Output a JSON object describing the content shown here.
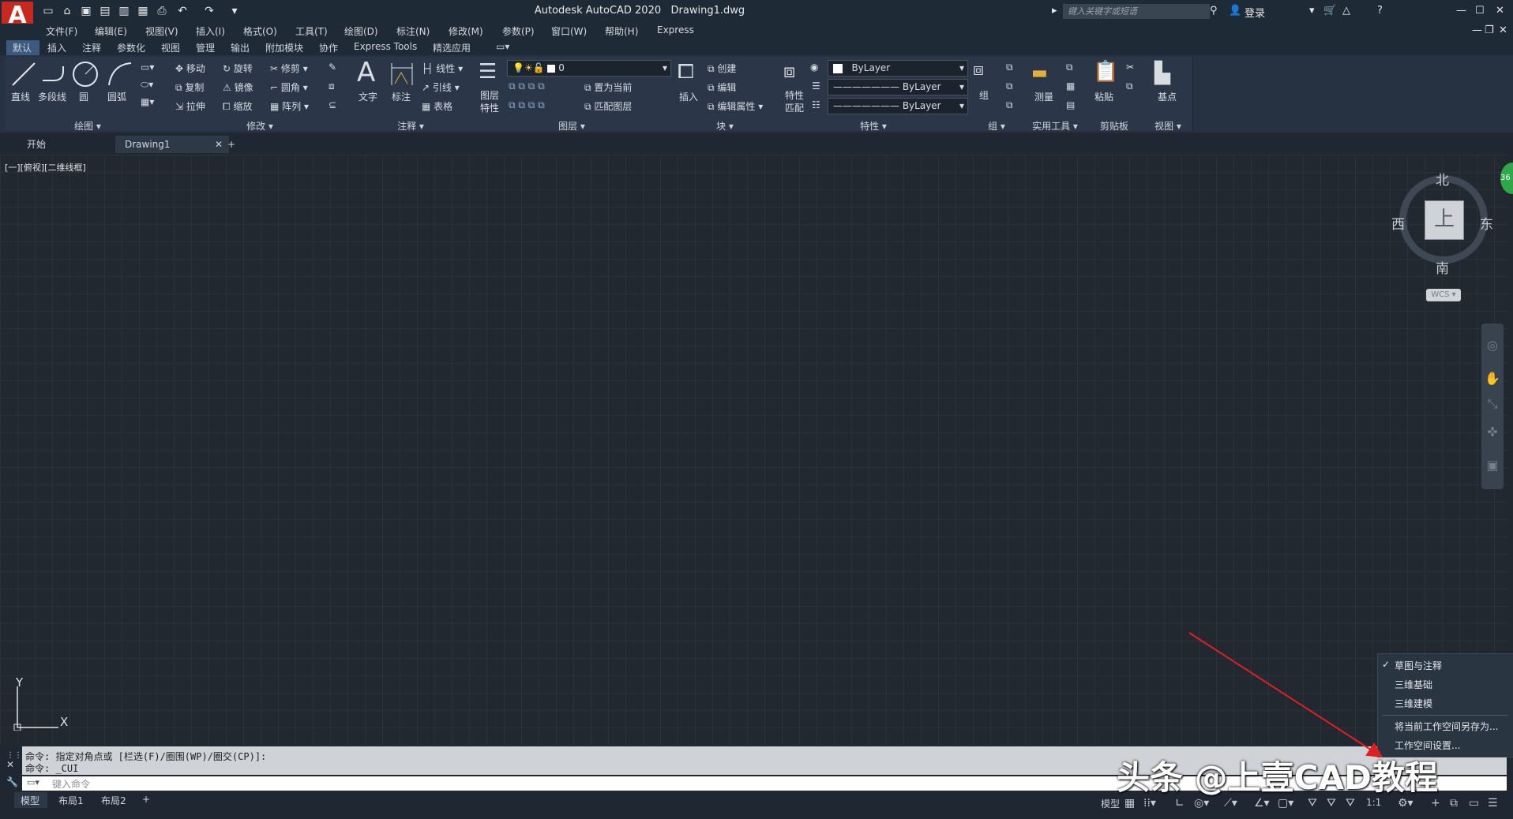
{
  "title": {
    "app": "Autodesk AutoCAD 2020",
    "file": "Drawing1.dwg",
    "search_placeholder": "键入关键字或短语",
    "login": "登录"
  },
  "menu": [
    "文件(F)",
    "编辑(E)",
    "视图(V)",
    "插入(I)",
    "格式(O)",
    "工具(T)",
    "绘图(D)",
    "标注(N)",
    "修改(M)",
    "参数(P)",
    "窗口(W)",
    "帮助(H)",
    "Express"
  ],
  "ribbon_tabs": [
    "默认",
    "插入",
    "注释",
    "参数化",
    "视图",
    "管理",
    "输出",
    "附加模块",
    "协作",
    "Express Tools",
    "精选应用"
  ],
  "ribbon": {
    "draw": {
      "title": "绘图",
      "line": "直线",
      "polyline": "多段线",
      "circle": "圆",
      "arc": "圆弧"
    },
    "modify": {
      "title": "修改",
      "move": "移动",
      "rotate": "旋转",
      "trim": "修剪",
      "copy": "复制",
      "mirror": "镜像",
      "fillet": "圆角",
      "stretch": "拉伸",
      "scale": "缩放",
      "array": "阵列"
    },
    "annotation": {
      "title": "注释",
      "text": "文字",
      "dimension": "标注",
      "linear": "线性",
      "leader": "引线",
      "table": "表格"
    },
    "layers": {
      "title": "图层",
      "layer_props_1": "图层",
      "layer_props_2": "特性",
      "current_layer": "0",
      "set_current": "置为当前",
      "match_layer": "匹配图层"
    },
    "block": {
      "title": "块",
      "insert": "插入",
      "create": "创建",
      "edit": "编辑",
      "edit_attr": "编辑属性"
    },
    "properties": {
      "title": "特性",
      "match_1": "特性",
      "match_2": "匹配",
      "color": "ByLayer",
      "linetype": "ByLayer",
      "lineweight": "ByLayer"
    },
    "groups": {
      "title": "组",
      "group": "组"
    },
    "utilities": {
      "title": "实用工具",
      "measure": "测量"
    },
    "clipboard": {
      "title": "剪贴板",
      "paste": "粘贴"
    },
    "view": {
      "title": "视图",
      "base": "基点"
    }
  },
  "file_tabs": {
    "start": "开始",
    "drawing": "Drawing1"
  },
  "viewport_label": "[一][俯视][二维线框]",
  "viewcube": {
    "north": "北",
    "south": "南",
    "east": "东",
    "west": "西",
    "face": "上",
    "wcs": "WCS"
  },
  "ucs": {
    "x": "X",
    "y": "Y"
  },
  "command": {
    "history": [
      "命令: 指定对角点或 [栏选(F)/圈围(WP)/圈交(CP)]:",
      "命令: _CUI"
    ],
    "placeholder": "键入命令"
  },
  "layout_tabs": [
    "模型",
    "布局1",
    "布局2"
  ],
  "status": {
    "model": "模型",
    "scale": "1:1"
  },
  "workspace_menu": {
    "items": [
      "草图与注释",
      "三维基础",
      "三维建模"
    ],
    "checked": "草图与注释",
    "actions": [
      "将当前工作空间另存为...",
      "工作空间设置..."
    ]
  },
  "watermark": "头条 @上壹CAD教程",
  "colors": {
    "accent": "#3b5a80",
    "background": "#212830",
    "arrow": "#e02020"
  }
}
